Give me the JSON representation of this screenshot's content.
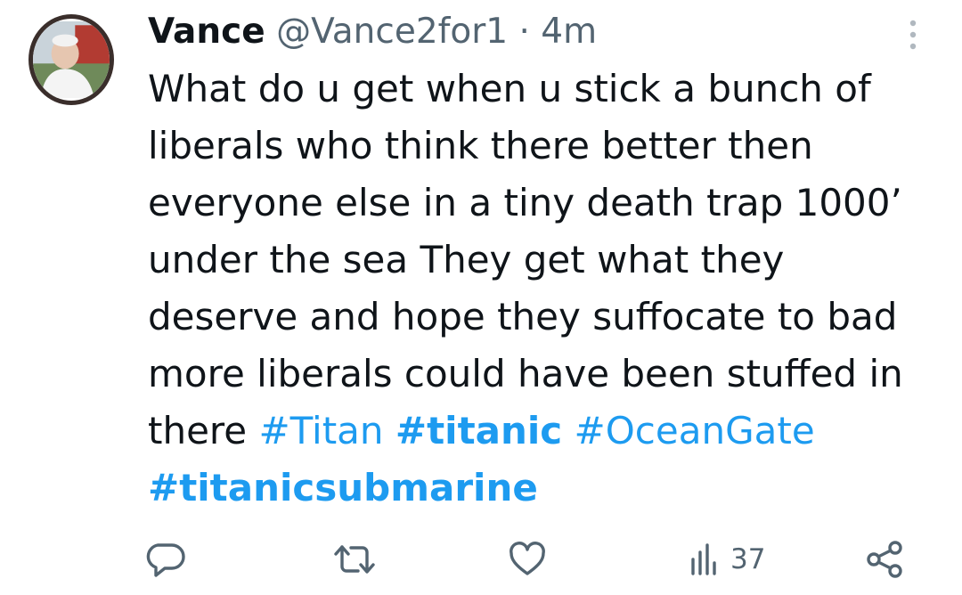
{
  "tweet": {
    "display_name": "Vance",
    "handle": "@Vance2for1",
    "separator": "·",
    "time": "4m",
    "text_lines": [
      "What do u get when u stick a bunch of",
      "liberals who think there better then",
      "everyone else in a tiny death trap 1000’",
      "under the sea They get what they",
      "deserve and hope they suffocate to bad",
      "more liberals could have been stuffed in"
    ],
    "text_last_prefix": "there",
    "hashtags": [
      "#Titan",
      "#titanic",
      "#OceanGate",
      "#titanicsubmarine"
    ]
  },
  "actions": {
    "reply_icon": "reply-icon",
    "retweet_icon": "retweet-icon",
    "like_icon": "heart-icon",
    "views_icon": "views-chart-icon",
    "views_count": "37",
    "share_icon": "share-icon"
  },
  "colors": {
    "text": "#0f1419",
    "secondary": "#536471",
    "link": "#1d9bf0"
  }
}
